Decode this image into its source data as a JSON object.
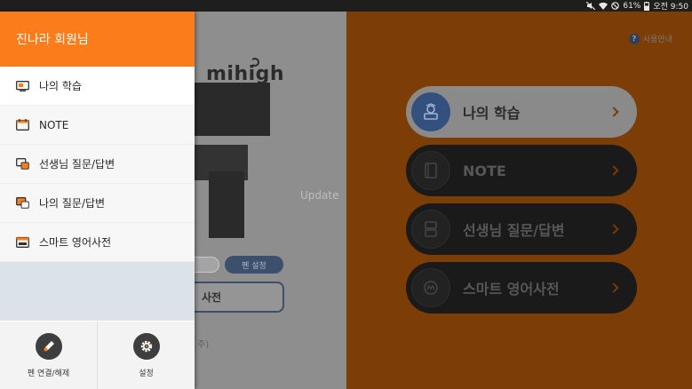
{
  "status_bar": {
    "battery": "61%",
    "time": "오전 9:50"
  },
  "drawer": {
    "user_name": "진나라 회원님",
    "items": [
      {
        "label": "나의 학습",
        "icon": "monitor-icon",
        "active": true
      },
      {
        "label": "NOTE",
        "icon": "calendar-icon",
        "active": false
      },
      {
        "label": "선생님 질문/답변",
        "icon": "chat-screen-icon",
        "active": false
      },
      {
        "label": "나의 질문/답변",
        "icon": "chat-screen-icon",
        "active": false
      },
      {
        "label": "스마트 영어사전",
        "icon": "calendar-abc-icon",
        "active": false
      }
    ],
    "bottom": [
      {
        "label": "펜 연결/해제",
        "icon": "pen-icon"
      },
      {
        "label": "설정",
        "icon": "gear-icon"
      }
    ]
  },
  "background": {
    "logo_text": "mihigh",
    "update_text": "Update",
    "pen_pill": "펜 설정",
    "dict_box": "사전",
    "note_text": "주)",
    "help_label": "사용안내",
    "menu": [
      {
        "label": "나의 학습",
        "active": true
      },
      {
        "label": "NOTE",
        "active": false
      },
      {
        "label": "선생님 질문/답변",
        "active": false
      },
      {
        "label": "스마트 영어사전",
        "active": false
      }
    ]
  },
  "colors": {
    "accent_orange": "#fa7c1b",
    "active_navy": "#34507e"
  }
}
